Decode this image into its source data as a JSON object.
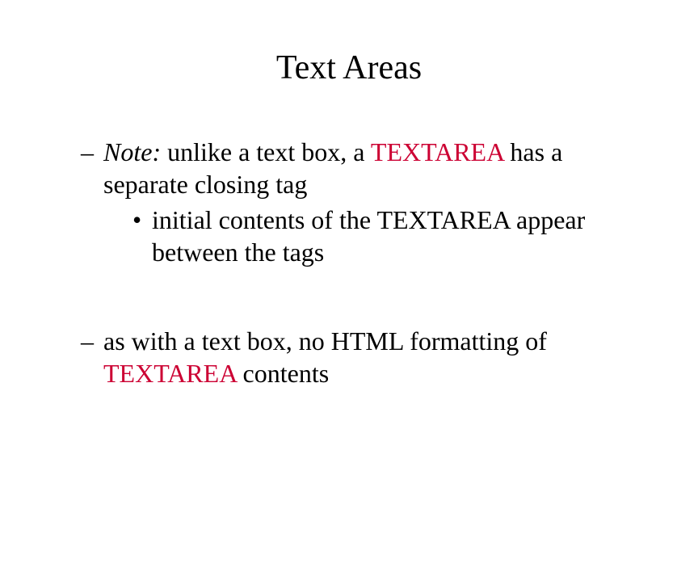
{
  "title": "Text Areas",
  "colors": {
    "accent": "#cc0033"
  },
  "content": {
    "bullet1": {
      "note_label": "Note:",
      "part_a": " unlike a text box, a ",
      "keyword": "TEXTAREA",
      "part_b": " has a separate closing tag",
      "sub": "initial contents of the TEXTAREA appear between the tags"
    },
    "bullet2": {
      "part_a": "as with a text box, no HTML formatting of ",
      "keyword": "TEXTAREA",
      "part_b": " contents"
    }
  }
}
